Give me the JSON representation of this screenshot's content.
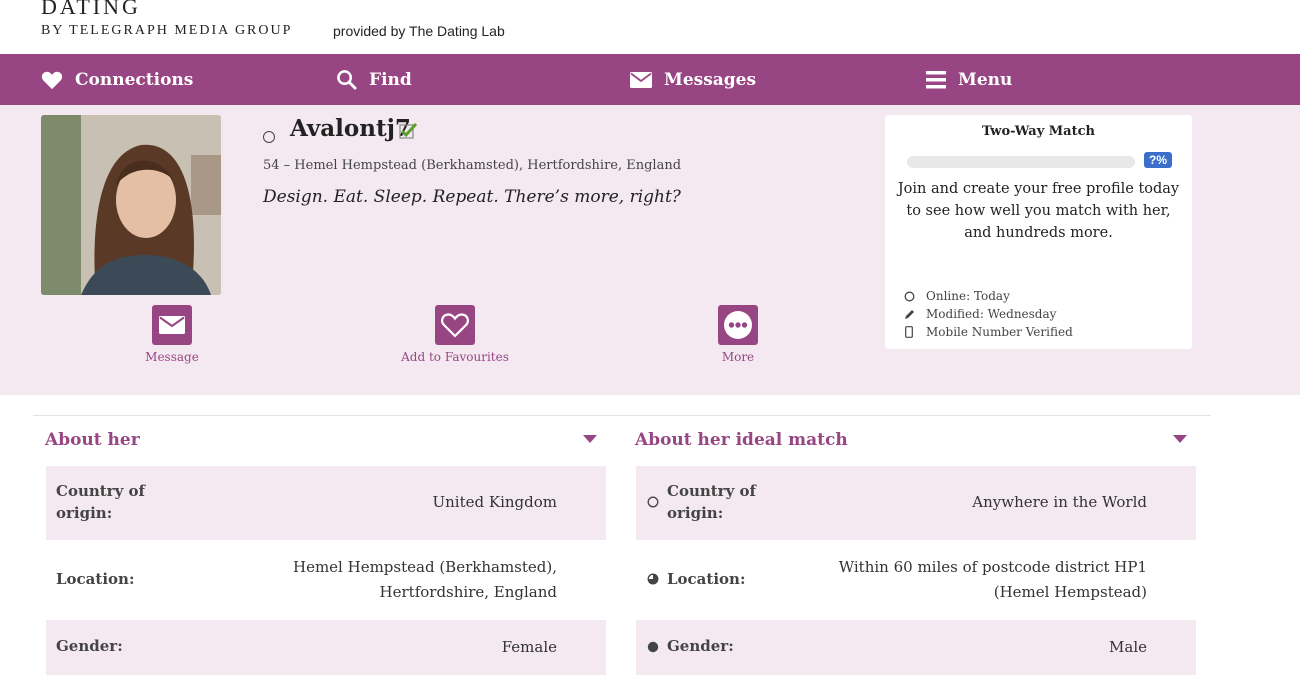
{
  "brand": {
    "title": "DATING",
    "by": "BY TELEGRAPH MEDIA GROUP",
    "provided": "provided by The Dating Lab"
  },
  "nav": {
    "items": [
      {
        "label": "Connections",
        "icon": "heart-icon"
      },
      {
        "label": "Find",
        "icon": "search-icon"
      },
      {
        "label": "Messages",
        "icon": "envelope-icon"
      },
      {
        "label": "Menu",
        "icon": "hamburger-icon"
      }
    ]
  },
  "profile": {
    "username": "Avalontj7",
    "location_line": "54 – Hemel Hempstead (Berkhamsted), Hertfordshire, England",
    "tagline": "Design. Eat. Sleep. Repeat. There’s more, right?",
    "actions": [
      {
        "label": "Message",
        "icon": "envelope-icon"
      },
      {
        "label": "Add to Favourites",
        "icon": "heart-outline-icon"
      },
      {
        "label": "More",
        "icon": "more-dots-icon"
      }
    ]
  },
  "match": {
    "title": "Two-Way Match",
    "percent": "?%",
    "description": "Join and create your free profile today to see how well you match with her, and hundreds more.",
    "meta": [
      {
        "label": "Online: Today",
        "icon": "circle-icon"
      },
      {
        "label": "Modified: Wednesday",
        "icon": "pencil-icon"
      },
      {
        "label": "Mobile Number Verified",
        "icon": "mobile-icon"
      }
    ]
  },
  "about_her": {
    "title": "About her",
    "rows": [
      {
        "key": "Country of origin:",
        "value": "United Kingdom"
      },
      {
        "key": "Location:",
        "value": "Hemel Hempstead (Berkhamsted), Hertfordshire, England"
      },
      {
        "key": "Gender:",
        "value": "Female"
      }
    ]
  },
  "ideal_match": {
    "title": "About her ideal match",
    "rows": [
      {
        "key": "Country of origin:",
        "value": "Anywhere in the World",
        "icon": "empty-circle-icon"
      },
      {
        "key": "Location:",
        "value": "Within 60 miles of postcode district HP1 (Hemel Hempstead)",
        "icon": "half-circle-icon"
      },
      {
        "key": "Gender:",
        "value": "Male",
        "icon": "full-circle-icon"
      }
    ]
  },
  "colors": {
    "brand_purple": "#974683",
    "band_pink": "#f4e9f0",
    "badge_blue": "#3b6fc9"
  }
}
